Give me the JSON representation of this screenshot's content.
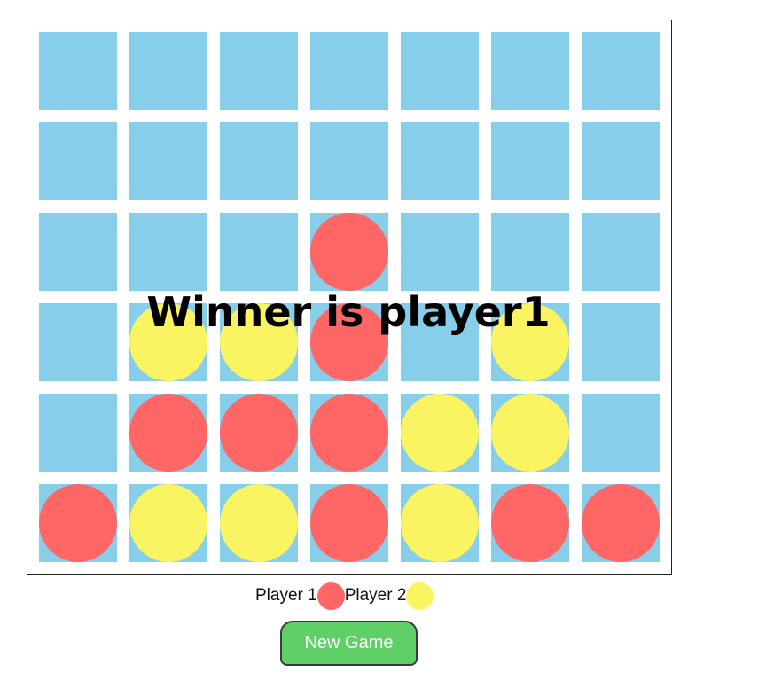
{
  "colors": {
    "cell": "#87ceeb",
    "player1": "#ff6666",
    "player2": "#fbf462",
    "button": "#5fd068"
  },
  "board": {
    "rows": 6,
    "columns": 7,
    "grid": [
      [
        0,
        0,
        0,
        0,
        0,
        0,
        0
      ],
      [
        0,
        0,
        0,
        0,
        0,
        0,
        0
      ],
      [
        0,
        0,
        0,
        1,
        0,
        0,
        0
      ],
      [
        0,
        2,
        2,
        1,
        0,
        2,
        0
      ],
      [
        0,
        1,
        1,
        1,
        2,
        2,
        0
      ],
      [
        1,
        2,
        2,
        1,
        2,
        1,
        1
      ]
    ]
  },
  "status": {
    "winner_text": "Winner is player1"
  },
  "legend": {
    "player1_label": "Player 1",
    "player2_label": "Player 2"
  },
  "controls": {
    "new_game_label": "New Game"
  }
}
